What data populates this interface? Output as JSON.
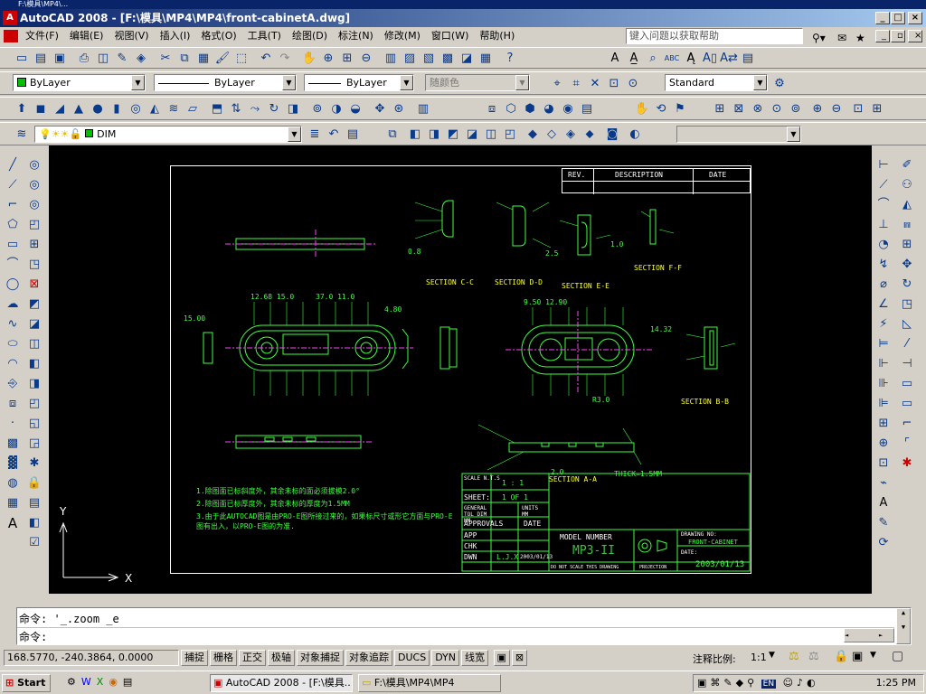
{
  "window": {
    "title": "AutoCAD 2008 - [F:\\模具\\MP4\\MP4\\front-cabinetA.dwg]",
    "top_strip": "F:\\模具\\MP4\\..."
  },
  "menu": {
    "items": [
      "文件(F)",
      "编辑(E)",
      "视图(V)",
      "插入(I)",
      "格式(O)",
      "工具(T)",
      "绘图(D)",
      "标注(N)",
      "修改(M)",
      "窗口(W)",
      "帮助(H)"
    ],
    "help_search_placeholder": "键入问题以获取帮助"
  },
  "properties": {
    "color": "ByLayer",
    "linetype": "ByLayer",
    "lineweight": "ByLayer",
    "plotstyle": "随颜色",
    "textstyle": "Standard",
    "layer": "DIM"
  },
  "drawing": {
    "revision_table": {
      "rev": "REV.",
      "description": "DESCRIPTION",
      "date": "DATE"
    },
    "sections": {
      "cc": "SECTION C-C",
      "dd": "SECTION D-D",
      "ee": "SECTION E-E",
      "ff": "SECTION F-F",
      "bb": "SECTION B-B",
      "aa": "SECTION A-A"
    },
    "notes": [
      "1.除图面已标斜度外，其余未标的面必须拔模2.0°",
      "2.除图面已标厚度外，其余未标的厚度为1.5MM",
      "3.由于此AUTOCAD图是由PRO-E图所接过来的，如果标尺寸或形它方面与PRO-E图有出入，以PRO-E图的为准."
    ],
    "title_block": {
      "scale_label": "SCALE N.T.S",
      "scale_value": "1 : 1",
      "sheet_label": "SHEET:",
      "sheet_value": "1 OF 1",
      "general_tol": "GENERAL TOL DIM MM",
      "units": "UNITS MM",
      "approvals": "APPROVALS",
      "date_col": "DATE",
      "app": "APP",
      "chk": "CHK",
      "dwn": "DWN",
      "dwn_name": "L.J.X",
      "dwn_date": "2003/01/13",
      "model_number_label": "MODEL NUMBER",
      "model_number": "MP3-II",
      "drawing_no_label": "DRAWING NO:",
      "drawing_no": "FRONT-CABINET",
      "date_label": "DATE:",
      "date_value": "2003/01/13",
      "do_not_scale": "DO NOT SCALE THIS DRAWING",
      "projection": "PROJECTION"
    },
    "ucs": {
      "x": "X",
      "y": "Y"
    }
  },
  "command": {
    "line1_prompt": "命令:",
    "line1_value": "'_.zoom _e",
    "line2_prompt": "命令:"
  },
  "status": {
    "coords": "168.5770,   -240.3864, 0.0000",
    "toggles": [
      "捕捉",
      "栅格",
      "正交",
      "极轴",
      "对象捕捉",
      "对象追踪",
      "DUCS",
      "DYN",
      "线宽"
    ],
    "annotation_scale_label": "注释比例:",
    "annotation_scale_value": "1:1"
  },
  "taskbar": {
    "start": "Start",
    "tasks": [
      "AutoCAD 2008 - [F:\\模具...",
      "F:\\模具\\MP4\\MP4"
    ],
    "tray_lang": "EN",
    "clock": "1:25 PM"
  },
  "colors": {
    "title_start": "#0a246a",
    "title_end": "#a6caf0",
    "canvas": "#000000",
    "geometry": "#40ff40",
    "section_text": "#ffff40",
    "centerline": "#ff40ff"
  }
}
